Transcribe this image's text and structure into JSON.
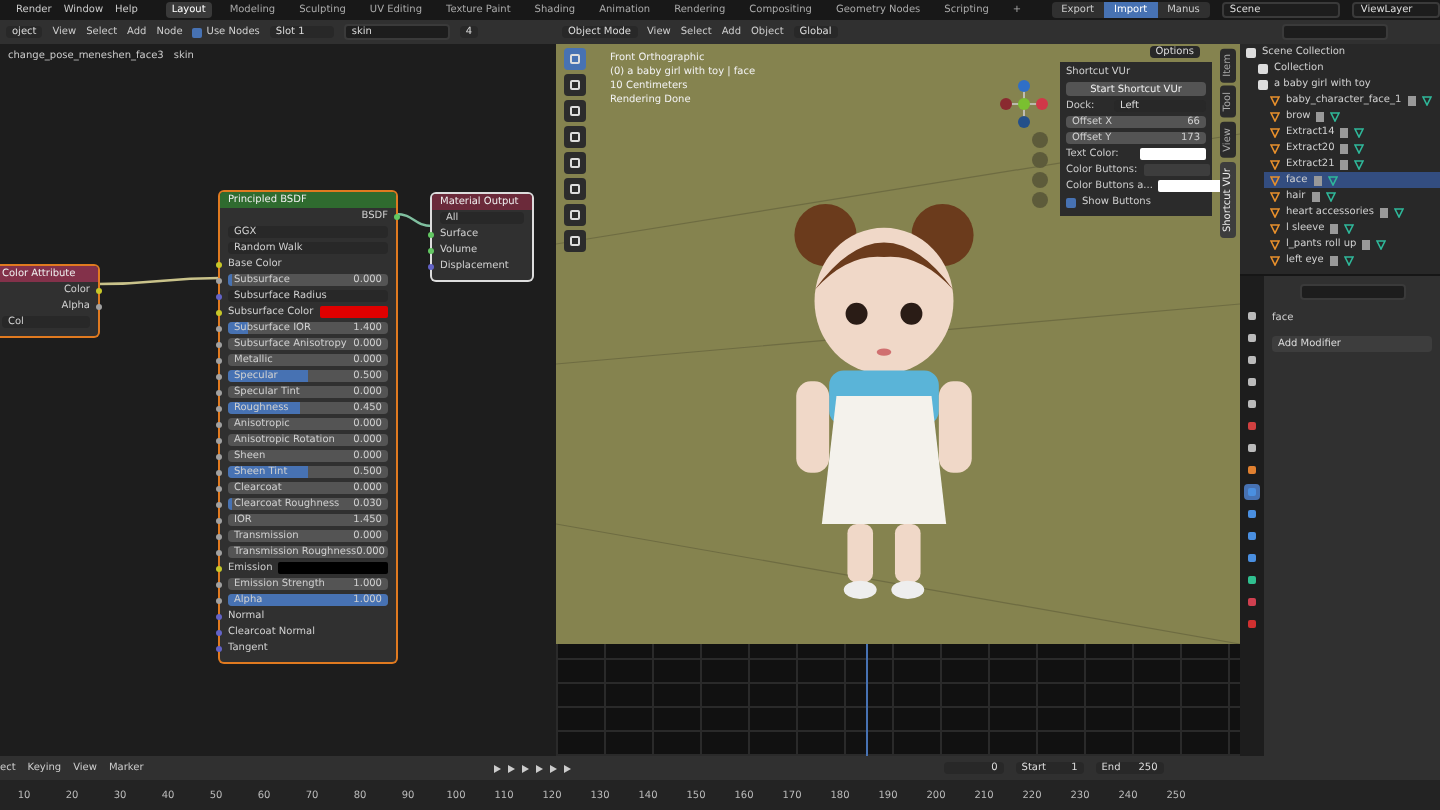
{
  "topbar": {
    "menus": [
      "Render",
      "Window",
      "Help"
    ],
    "workspaces": [
      {
        "label": "Layout",
        "selected": true
      },
      {
        "label": "Modeling",
        "selected": false
      },
      {
        "label": "Sculpting",
        "selected": false
      },
      {
        "label": "UV Editing",
        "selected": false
      },
      {
        "label": "Texture Paint",
        "selected": false
      },
      {
        "label": "Shading",
        "selected": false
      },
      {
        "label": "Animation",
        "selected": false
      },
      {
        "label": "Rendering",
        "selected": false
      },
      {
        "label": "Compositing",
        "selected": false
      },
      {
        "label": "Geometry Nodes",
        "selected": false
      },
      {
        "label": "Scripting",
        "selected": false
      }
    ],
    "add_tab": "+",
    "addon_buttons": [
      {
        "label": "Export",
        "selected": false
      },
      {
        "label": "Import",
        "selected": true
      },
      {
        "label": "Manus",
        "selected": false
      }
    ],
    "scene": "Scene",
    "view_layer": "ViewLayer"
  },
  "node_editor": {
    "header": {
      "editor_menu": "oject",
      "menus": [
        "View",
        "Select",
        "Add",
        "Node"
      ],
      "use_nodes": {
        "label": "Use Nodes",
        "checked": true
      },
      "slot": "Slot 1",
      "material": "skin",
      "users": "4"
    },
    "breadcrumb": [
      "change_pose_meneshen_face3",
      "skin"
    ],
    "nodes": [
      {
        "kind": "attribute",
        "title": "Color Attribute",
        "outputs": [
          {
            "label": "Color",
            "color": "#c7c729"
          },
          {
            "label": "Alpha",
            "color": "#a1a1a1"
          }
        ],
        "field": "Col"
      },
      {
        "kind": "bsdf",
        "title": "Principled BSDF",
        "output": "BSDF",
        "dropdowns": [
          "GGX",
          "Random Walk"
        ],
        "inputs": [
          {
            "kind": "socket",
            "label": "Base Color",
            "color": "#c7c729"
          },
          {
            "kind": "slider",
            "label": "Subsurface",
            "value": "0.000",
            "level": 0.02,
            "color": "#a1a1a1"
          },
          {
            "kind": "dropdown",
            "label": "Subsurface Radius",
            "color": "#6363c7"
          },
          {
            "kind": "swatch",
            "label": "Subsurface Color",
            "color": "#e00000"
          },
          {
            "kind": "slider",
            "label": "Subsurface IOR",
            "value": "1.400",
            "level": 0.13,
            "color": "#a1a1a1"
          },
          {
            "kind": "slider",
            "label": "Subsurface Anisotropy",
            "value": "0.000",
            "level": 0,
            "color": "#a1a1a1"
          },
          {
            "kind": "slider",
            "label": "Metallic",
            "value": "0.000",
            "level": 0,
            "color": "#a1a1a1"
          },
          {
            "kind": "slider",
            "label": "Specular",
            "value": "0.500",
            "level": 0.5,
            "color": "#a1a1a1"
          },
          {
            "kind": "slider",
            "label": "Specular Tint",
            "value": "0.000",
            "level": 0,
            "color": "#a1a1a1"
          },
          {
            "kind": "slider",
            "label": "Roughness",
            "value": "0.450",
            "level": 0.45,
            "color": "#a1a1a1"
          },
          {
            "kind": "slider",
            "label": "Anisotropic",
            "value": "0.000",
            "level": 0,
            "color": "#a1a1a1"
          },
          {
            "kind": "slider",
            "label": "Anisotropic Rotation",
            "value": "0.000",
            "level": 0,
            "color": "#a1a1a1"
          },
          {
            "kind": "slider",
            "label": "Sheen",
            "value": "0.000",
            "level": 0,
            "color": "#a1a1a1"
          },
          {
            "kind": "slider",
            "label": "Sheen Tint",
            "value": "0.500",
            "level": 0.5,
            "color": "#a1a1a1"
          },
          {
            "kind": "slider",
            "label": "Clearcoat",
            "value": "0.000",
            "level": 0,
            "color": "#a1a1a1"
          },
          {
            "kind": "slider",
            "label": "Clearcoat Roughness",
            "value": "0.030",
            "level": 0.03,
            "color": "#a1a1a1"
          },
          {
            "kind": "slider",
            "label": "IOR",
            "value": "1.450",
            "level": 0,
            "color": "#a1a1a1"
          },
          {
            "kind": "slider",
            "label": "Transmission",
            "value": "0.000",
            "level": 0,
            "color": "#a1a1a1"
          },
          {
            "kind": "slider",
            "label": "Transmission Roughness",
            "value": "0.000",
            "level": 0,
            "color": "#a1a1a1"
          },
          {
            "kind": "swatch",
            "label": "Emission",
            "color": "#000000"
          },
          {
            "kind": "slider",
            "label": "Emission Strength",
            "value": "1.000",
            "level": 0,
            "color": "#a1a1a1"
          },
          {
            "kind": "slider",
            "label": "Alpha",
            "value": "1.000",
            "level": 1,
            "color": "#a1a1a1"
          },
          {
            "kind": "socket",
            "label": "Normal",
            "color": "#6363c7"
          },
          {
            "kind": "socket",
            "label": "Clearcoat Normal",
            "color": "#6363c7"
          },
          {
            "kind": "socket",
            "label": "Tangent",
            "color": "#6363c7"
          }
        ]
      },
      {
        "kind": "output",
        "title": "Material Output",
        "target": "All",
        "inputs": [
          {
            "label": "Surface",
            "color": "#63c763"
          },
          {
            "label": "Volume",
            "color": "#63c763"
          },
          {
            "label": "Displacement",
            "color": "#6363c7"
          }
        ]
      }
    ]
  },
  "viewport": {
    "header": {
      "mode": "Object Mode",
      "menus": [
        "View",
        "Select",
        "Add",
        "Object"
      ],
      "orientation": "Global"
    },
    "options": "Options",
    "overlay_text": [
      "Front Orthographic",
      "(0) a baby girl with toy | face",
      "10 Centimeters",
      "Rendering Done"
    ],
    "tools": [
      {
        "selected": true
      },
      {
        "selected": false
      },
      {
        "selected": false
      },
      {
        "selected": false
      },
      {
        "selected": false
      },
      {
        "selected": false
      },
      {
        "selected": false
      },
      {
        "selected": false
      }
    ],
    "n_panel": {
      "title": "Shortcut VUr",
      "start_button": "Start Shortcut VUr",
      "dock": {
        "label": "Dock:",
        "value": "Left"
      },
      "offsets": [
        {
          "label": "Offset X",
          "value": "66"
        },
        {
          "label": "Offset Y",
          "value": "173"
        }
      ],
      "colors": [
        {
          "label": "Text Color:",
          "color": "#ffffff"
        },
        {
          "label": "Color Buttons:",
          "color": "#3d3d3d"
        },
        {
          "label": "Color Buttons a...",
          "color": "#ffffff"
        }
      ],
      "show_buttons": {
        "label": "Show Buttons",
        "checked": true
      }
    },
    "side_tabs": [
      {
        "label": "Item",
        "selected": false
      },
      {
        "label": "Tool",
        "selected": false
      },
      {
        "label": "View",
        "selected": false
      },
      {
        "label": "Shortcut VUr",
        "selected": true
      }
    ]
  },
  "outliner": {
    "items": [
      {
        "label": "Scene Collection",
        "kind": "collection",
        "selected": false,
        "children": [
          {
            "label": "Collection",
            "kind": "collection",
            "selected": false
          },
          {
            "label": "a baby girl with toy",
            "kind": "collection",
            "selected": false,
            "children": [
              {
                "label": "baby_character_face_1",
                "kind": "object",
                "selected": false
              },
              {
                "label": "brow",
                "kind": "object",
                "selected": false
              },
              {
                "label": "Extract14",
                "kind": "object",
                "selected": false
              },
              {
                "label": "Extract20",
                "kind": "object",
                "selected": false
              },
              {
                "label": "Extract21",
                "kind": "object",
                "selected": false
              },
              {
                "label": "face",
                "kind": "object",
                "selected": true
              },
              {
                "label": "hair",
                "kind": "object",
                "selected": false
              },
              {
                "label": "heart accessories",
                "kind": "object",
                "selected": false
              },
              {
                "label": "l sleeve",
                "kind": "object",
                "selected": false
              },
              {
                "label": "l_pants roll up",
                "kind": "object",
                "selected": false
              },
              {
                "label": "left eye",
                "kind": "object",
                "selected": false
              }
            ]
          }
        ]
      }
    ]
  },
  "properties": {
    "object_name": "face",
    "add_modifier": "Add Modifier",
    "tabs": [
      {
        "selected": false
      },
      {
        "selected": false
      },
      {
        "selected": false
      },
      {
        "selected": false
      },
      {
        "selected": false
      },
      {
        "selected": false
      },
      {
        "selected": false
      },
      {
        "selected": false
      },
      {
        "selected": true
      },
      {
        "selected": false
      },
      {
        "selected": false
      },
      {
        "selected": false
      },
      {
        "selected": false
      },
      {
        "selected": false
      },
      {
        "selected": false
      }
    ]
  },
  "timeline": {
    "menus": [
      "ect",
      "Keying",
      "View",
      "Marker"
    ],
    "current_frame": "0",
    "start": {
      "label": "Start",
      "value": "1"
    },
    "end": {
      "label": "End",
      "value": "250"
    },
    "ruler": [
      "10",
      "20",
      "30",
      "40",
      "50",
      "60",
      "70",
      "80",
      "90",
      "100",
      "110",
      "120",
      "130",
      "140",
      "150",
      "160",
      "170",
      "180",
      "190",
      "200",
      "210",
      "220",
      "230",
      "240",
      "250"
    ]
  }
}
